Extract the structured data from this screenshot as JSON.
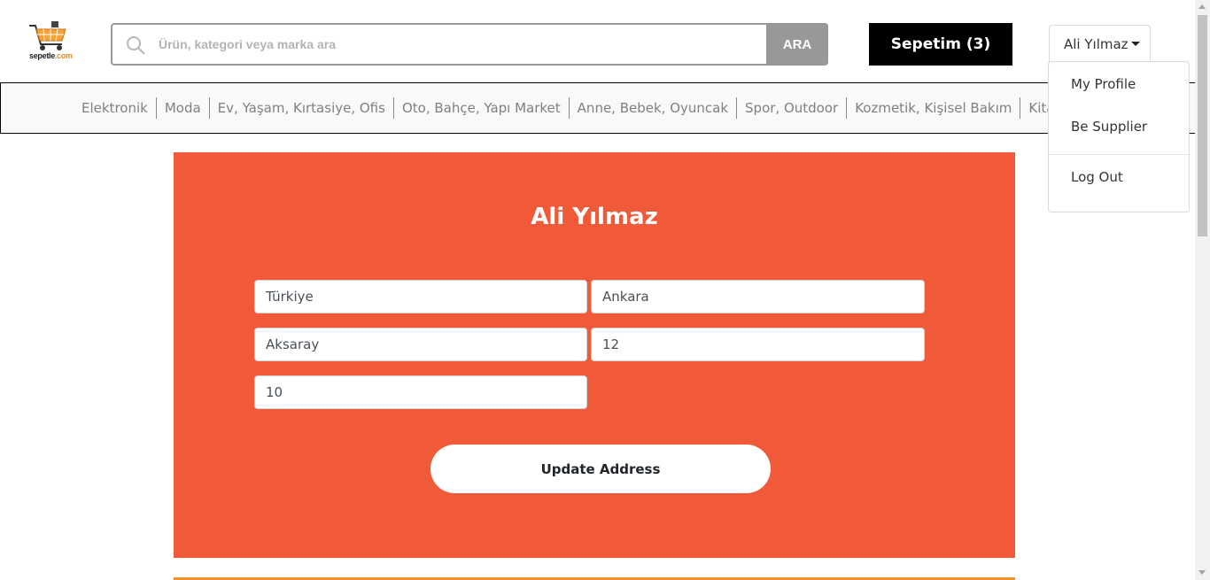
{
  "brand": {
    "name_part1": "sepetle",
    "name_part2": ".com",
    "accent": "#f08a1c"
  },
  "search": {
    "placeholder": "Ürün, kategori veya marka ara",
    "button_label": "ARA",
    "icon": "search-icon"
  },
  "cart": {
    "label": "Sepetim (3)"
  },
  "user": {
    "name": "Ali Yılmaz",
    "menu": [
      {
        "label": "My Profile"
      },
      {
        "label": "Be Supplier"
      },
      {
        "label": "Log Out"
      }
    ]
  },
  "categories": [
    "Elektronik",
    "Moda",
    "Ev, Yaşam, Kırtasiye, Ofis",
    "Oto, Bahçe, Yapı Market",
    "Anne, Bebek, Oyuncak",
    "Spor, Outdoor",
    "Kozmetik, Kişisel Bakım",
    "Kitap, Film, Müzik"
  ],
  "address_form": {
    "title": "Ali Yılmaz",
    "country": "Türkiye",
    "city": "Ankara",
    "district": "Aksaray",
    "street_no": "12",
    "door_no": "10",
    "submit_label": "Update Address",
    "background": "#f05a38"
  }
}
